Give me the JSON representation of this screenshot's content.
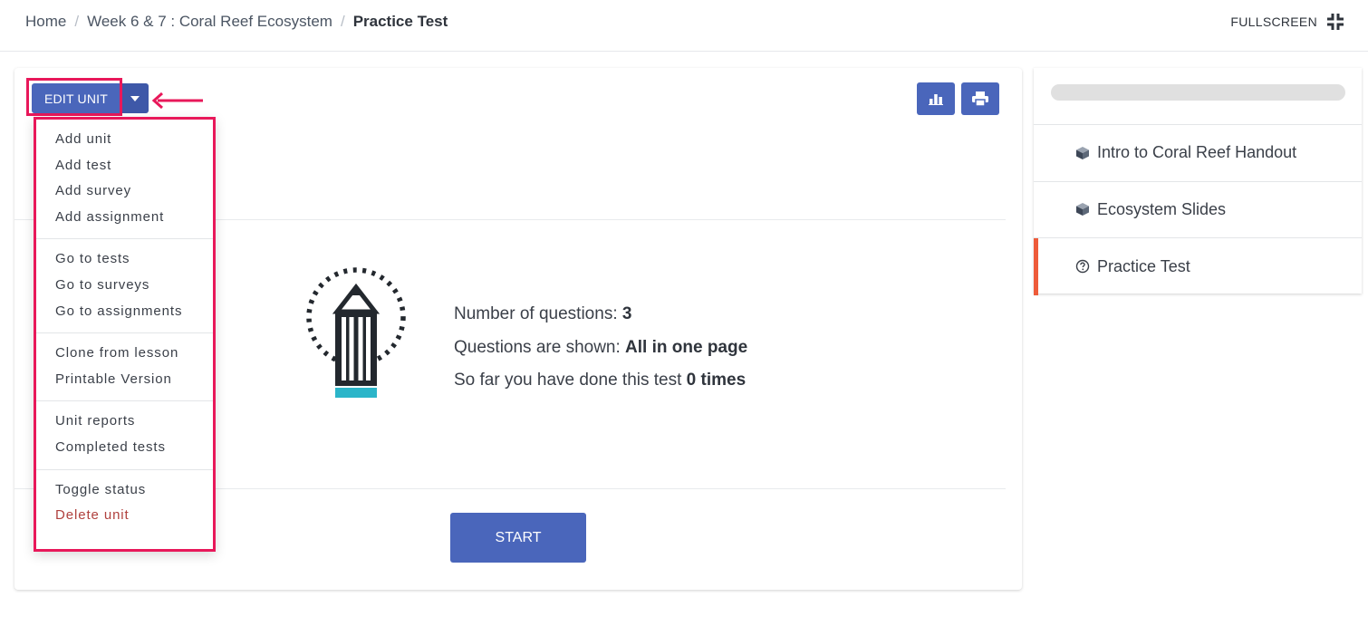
{
  "breadcrumb": {
    "home": "Home",
    "section": "Week 6 & 7 : Coral Reef Ecosystem",
    "current": "Practice Test",
    "separator": "/"
  },
  "header": {
    "fullscreen_label": "FULLSCREEN"
  },
  "toolbar": {
    "edit_unit_label": "EDIT UNIT"
  },
  "menu": {
    "groups": [
      [
        "Add unit",
        "Add test",
        "Add survey",
        "Add assignment"
      ],
      [
        "Go to tests",
        "Go to surveys",
        "Go to assignments"
      ],
      [
        "Clone from lesson",
        "Printable Version"
      ],
      [
        "Unit reports",
        "Completed tests"
      ],
      [
        "Toggle status",
        "Delete unit"
      ]
    ]
  },
  "test_info": {
    "questions_label": "Number of questions: ",
    "questions_value": "3",
    "shown_label": "Questions are shown: ",
    "shown_value": "All in one page",
    "done_label": "So far you have done this test ",
    "done_value": "0 times"
  },
  "start_label": "START",
  "sidebar": {
    "items": [
      {
        "label": "Intro to Coral Reef Handout",
        "icon": "cube-icon",
        "active": false
      },
      {
        "label": "Ecosystem Slides",
        "icon": "cube-icon",
        "active": false
      },
      {
        "label": "Practice Test",
        "icon": "question-circle-icon",
        "active": true
      }
    ]
  },
  "colors": {
    "primary": "#4a66bb",
    "highlight": "#e8185a",
    "active_marker": "#ee5b3a",
    "danger": "#b0413e",
    "pencil_accent": "#2bb5c9"
  }
}
